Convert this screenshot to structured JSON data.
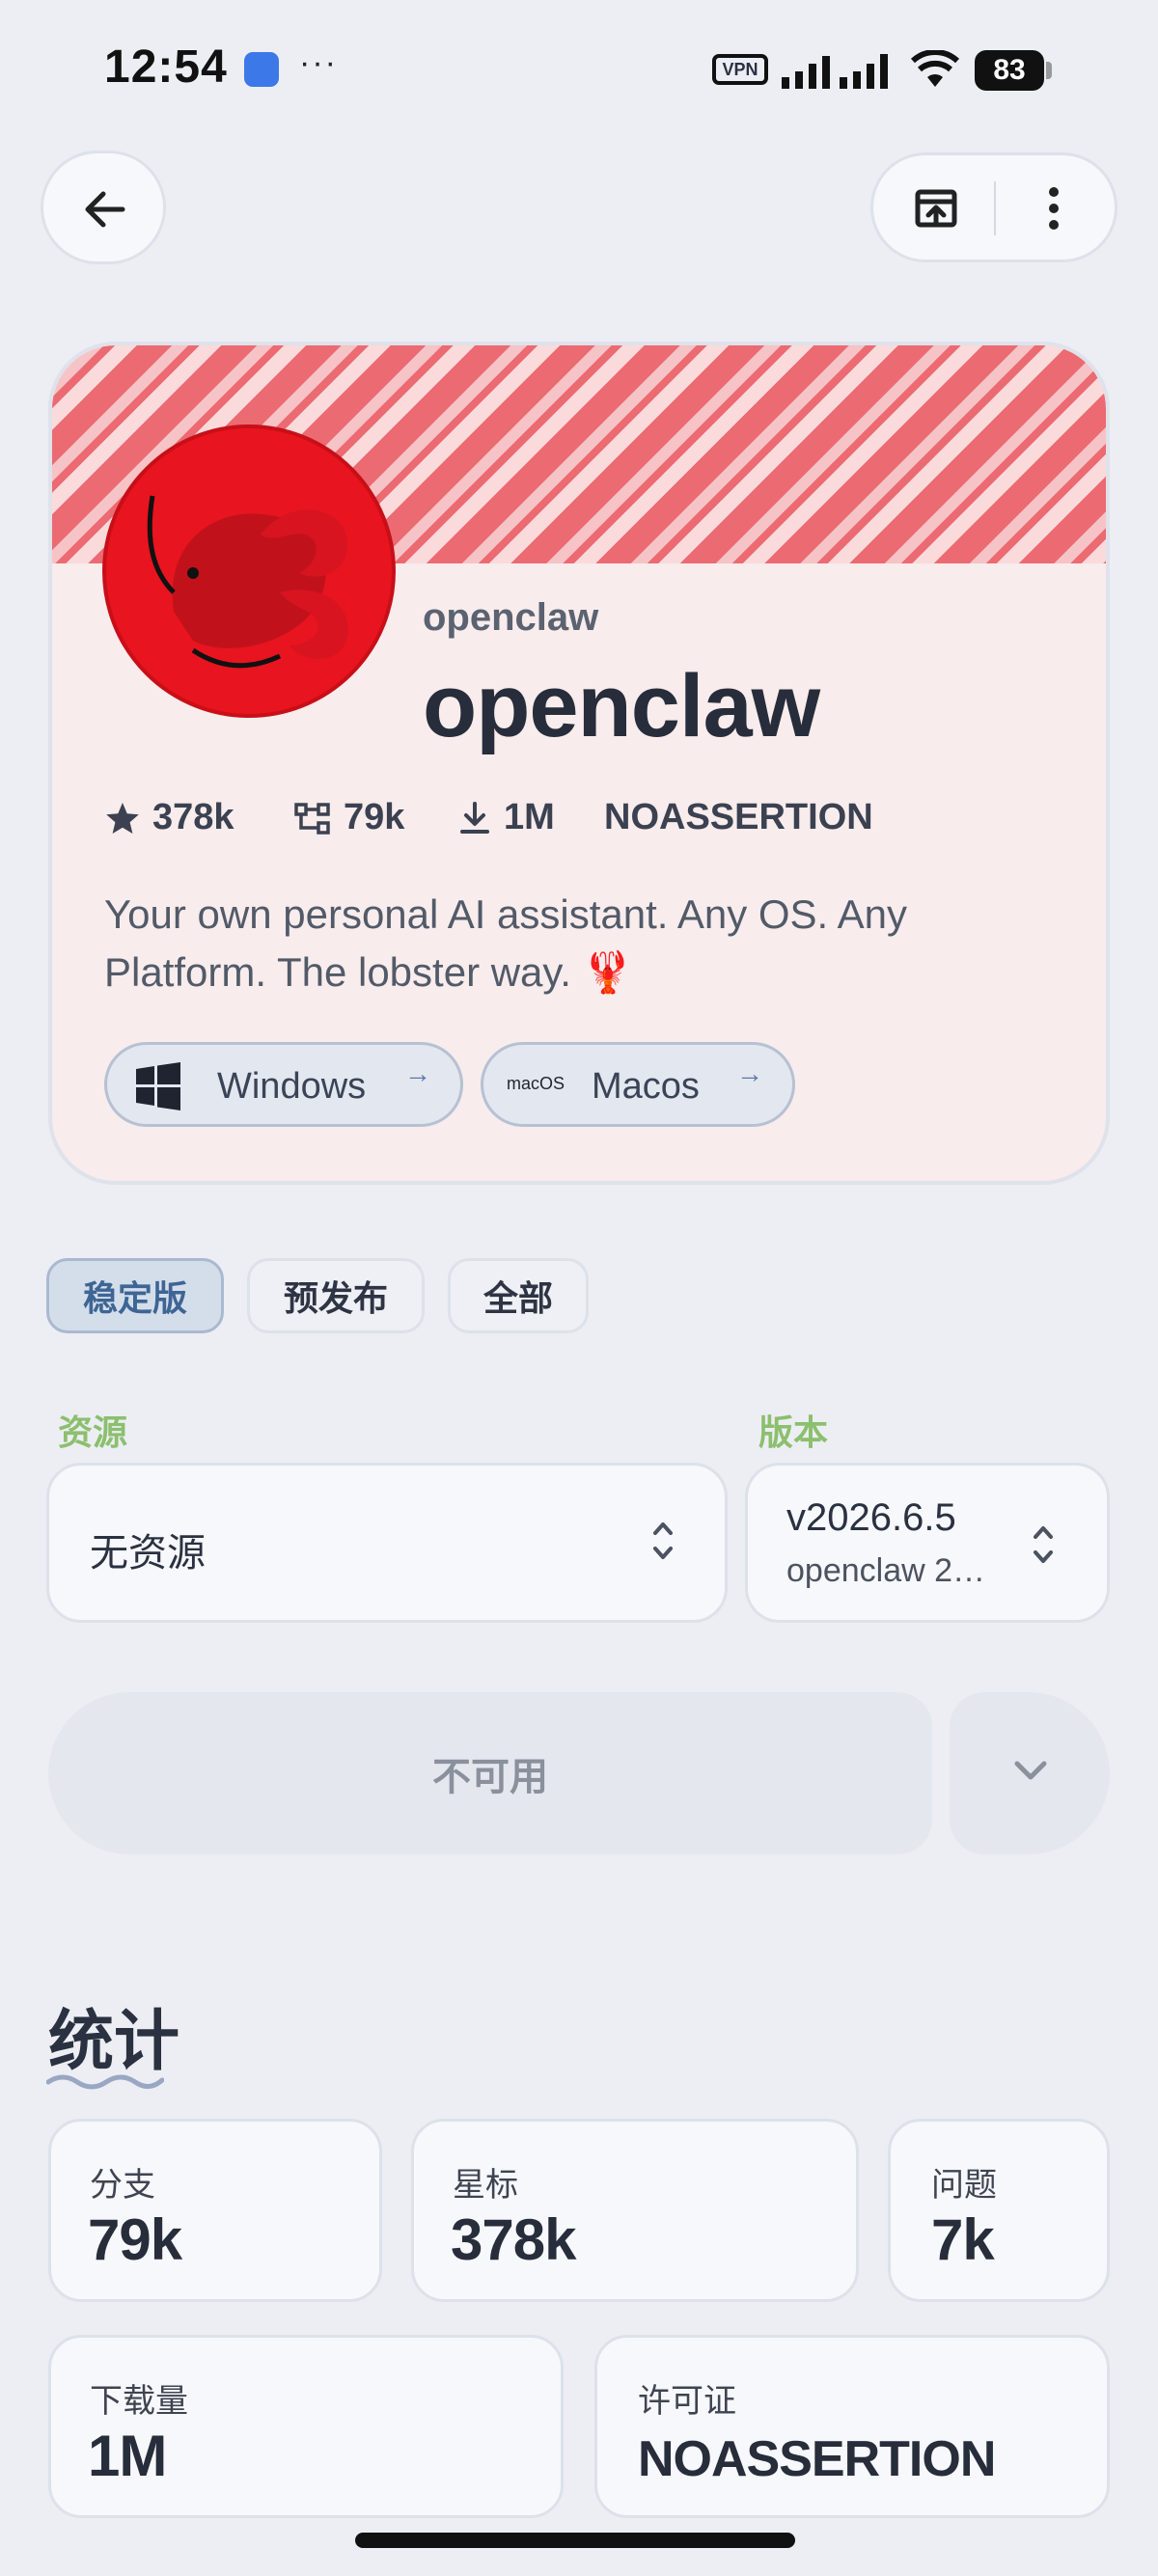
{
  "status_bar": {
    "time": "12:54",
    "dots": "···",
    "vpn": "VPN",
    "battery": "83"
  },
  "repo": {
    "owner": "openclaw",
    "name": "openclaw",
    "stars": "378k",
    "forks": "79k",
    "downloads": "1M",
    "license": "NOASSERTION",
    "description": "Your own personal AI assistant. Any OS. Any Platform. The lobster way. 🦞",
    "logo_color": "#e8141f"
  },
  "platforms": [
    {
      "label": "Windows",
      "arrow": "→"
    },
    {
      "label": "Macos",
      "icon_text": "macOS",
      "arrow": "→"
    }
  ],
  "release_tabs": [
    {
      "label": "稳定版",
      "active": true
    },
    {
      "label": "预发布",
      "active": false
    },
    {
      "label": "全部",
      "active": false
    }
  ],
  "asset": {
    "label": "资源",
    "value": "无资源"
  },
  "version": {
    "label": "版本",
    "value": "v2026.6.5",
    "sub": "openclaw 2…"
  },
  "download_button": {
    "label": "不可用"
  },
  "stats": {
    "title": "统计",
    "cards": [
      {
        "label": "分支",
        "value": "79k"
      },
      {
        "label": "星标",
        "value": "378k"
      },
      {
        "label": "问题",
        "value": "7k"
      },
      {
        "label": "下载量",
        "value": "1M"
      },
      {
        "label": "许可证",
        "value": "NOASSERTION"
      }
    ]
  },
  "colors": {
    "accent": "#3e6594",
    "label_green": "#8cbf6e",
    "stripe": "#ec6a72",
    "card_bg": "#f8ecec"
  }
}
